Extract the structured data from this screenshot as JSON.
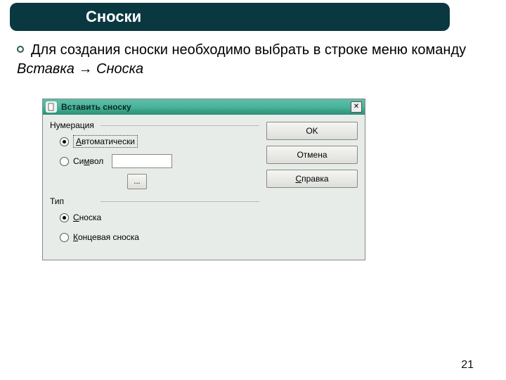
{
  "slide": {
    "title": "Сноски",
    "body_prefix": "Для создания сноски необходимо выбрать в строке меню команду ",
    "body_menu": "Вставка",
    "body_arrow": " → ",
    "body_item": "Сноска",
    "page_number": "21"
  },
  "dialog": {
    "title": "Вставить сноску",
    "close_glyph": "✕",
    "numbering": {
      "group_label": "Нумерация",
      "auto_prefix": "А",
      "auto_rest": "втоматически",
      "symbol_prefix": "Си",
      "symbol_key": "м",
      "symbol_rest": "вол",
      "browse_label": "..."
    },
    "type": {
      "group_label": "Тип",
      "footnote_key": "С",
      "footnote_rest": "носка",
      "endnote_key": "К",
      "endnote_rest": "онцевая сноска"
    },
    "buttons": {
      "ok": "OK",
      "cancel": "Отмена",
      "help_key": "С",
      "help_rest": "правка"
    }
  }
}
